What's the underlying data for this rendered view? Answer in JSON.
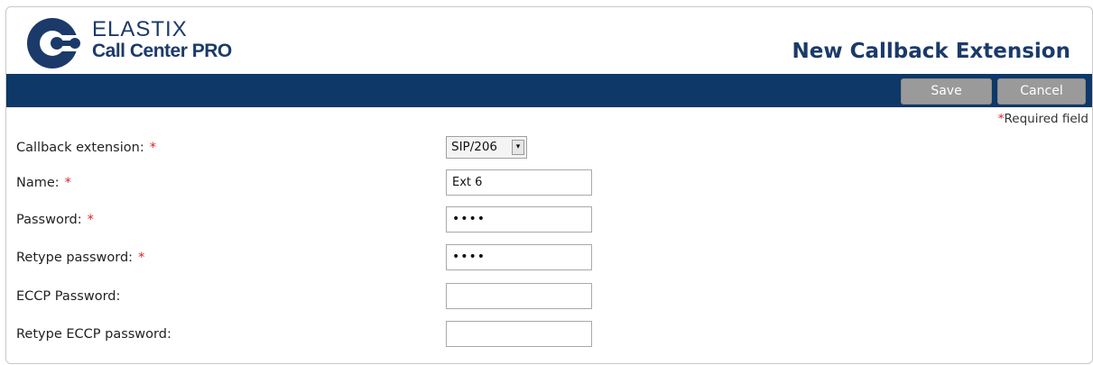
{
  "header": {
    "logo_line1": "ELASTIX",
    "logo_line2": "Call Center PRO",
    "title": "New Callback Extension"
  },
  "toolbar": {
    "save_label": "Save",
    "cancel_label": "Cancel"
  },
  "required_note": {
    "asterisk": "*",
    "text": "Required field"
  },
  "form": {
    "callback_extension": {
      "label": "Callback extension:",
      "required": "*",
      "value": "SIP/206"
    },
    "name": {
      "label": "Name:",
      "required": "*",
      "value": "Ext 6"
    },
    "password": {
      "label": "Password:",
      "required": "*",
      "value": "••••"
    },
    "retype_password": {
      "label": "Retype password:",
      "required": "*",
      "value": "••••"
    },
    "eccp_password": {
      "label": "ECCP Password:",
      "value": ""
    },
    "retype_eccp_password": {
      "label": "Retype ECCP password:",
      "value": ""
    }
  },
  "colors": {
    "brand_blue": "#1b3a6a",
    "bar_blue": "#0d3868",
    "button_gray": "#9a9a9a",
    "required_red": "#e02020"
  },
  "icons": {
    "logo": "elastix-logo-icon",
    "select_arrow": "dropdown-arrow-icon"
  }
}
